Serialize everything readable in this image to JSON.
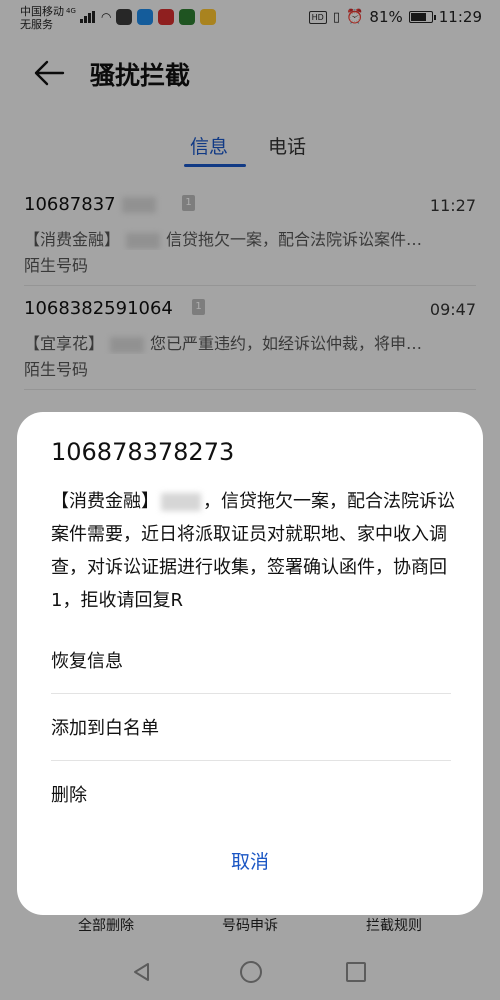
{
  "status_bar": {
    "carrier_line1": "中国移动",
    "carrier_net": "4G",
    "carrier_line2": "无服务",
    "battery_percent": 81,
    "battery_text": "81%",
    "time": "11:29",
    "hd_label": "HD"
  },
  "header": {
    "title": "骚扰拦截",
    "back_icon": "back-arrow-icon"
  },
  "tabs": [
    {
      "label": "信息",
      "active": true
    },
    {
      "label": "电话",
      "active": false
    }
  ],
  "messages": [
    {
      "number": "10687837",
      "badge": "1",
      "time": "11:27",
      "preview_tag": "【消费金融】",
      "preview_text": "信贷拖欠一案，配合法院诉讼案件…",
      "category": "陌生号码"
    },
    {
      "number": "1068382591064",
      "badge": "1",
      "time": "09:47",
      "preview_tag": "【宜享花】",
      "preview_text": "您已严重违约，如经诉讼仲裁，将申…",
      "category": "陌生号码"
    }
  ],
  "dialog": {
    "number": "106878378273",
    "body_prefix": "【消费金融】",
    "body_text": "，信贷拖欠一案，配合法院诉讼案件需要，近日将派取证员对就职地、家中收入调查，对诉讼证据进行收集，签署确认函件，协商回1，拒收请回复R",
    "options": [
      "恢复信息",
      "添加到白名单",
      "删除"
    ],
    "cancel": "取消"
  },
  "bottom_actions": [
    "全部删除",
    "号码申诉",
    "拦截规则"
  ],
  "colors": {
    "accent": "#1a56c4",
    "overlay": "rgba(0,0,0,0.32)"
  }
}
